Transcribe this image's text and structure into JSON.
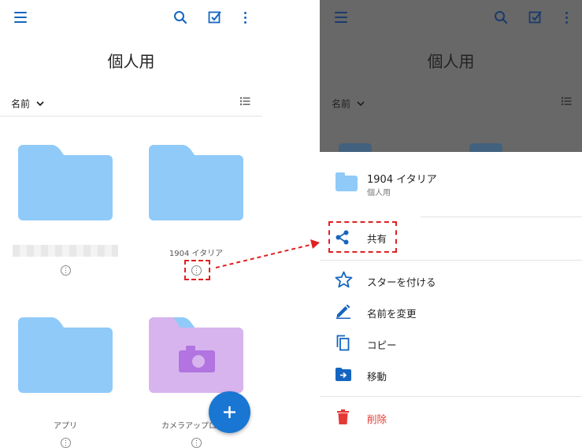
{
  "left": {
    "title": "個人用",
    "sort_label": "名前",
    "folders": [
      {
        "name": ""
      },
      {
        "name": "1904 イタリア"
      },
      {
        "name": "アプリ"
      },
      {
        "name": "カメラアップロード"
      }
    ]
  },
  "right": {
    "title": "個人用",
    "sort_label": "名前",
    "sheet": {
      "folder_name": "1904 イタリア",
      "folder_location": "個人用",
      "items": [
        {
          "icon": "share-icon",
          "label": "共有"
        },
        {
          "icon": "star-outline-icon",
          "label": "スターを付ける"
        },
        {
          "icon": "pencil-icon",
          "label": "名前を変更"
        },
        {
          "icon": "copy-icon",
          "label": "コピー"
        },
        {
          "icon": "move-folder-icon",
          "label": "移動"
        },
        {
          "icon": "trash-icon",
          "label": "削除"
        }
      ]
    }
  },
  "colors": {
    "accent": "#1565c0",
    "folder": "#90caf9",
    "camera_folder": "#d7b4ee",
    "fab": "#1976d2",
    "highlight": "#e02020",
    "delete": "#e53935",
    "overlay": "#666666"
  }
}
